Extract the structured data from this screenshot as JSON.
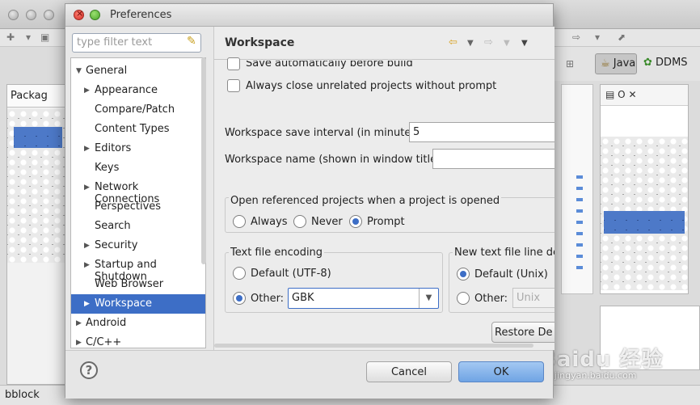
{
  "background": {
    "perspectives": {
      "java": "Java",
      "ddms": "DDMS"
    },
    "package_tab": "Packag",
    "outline_tab": "O",
    "status_text": "bblock",
    "watermark": "Baidu 经验",
    "watermark_sub": "jingyan.baidu.com"
  },
  "dialog": {
    "title": "Preferences",
    "filter_placeholder": "type filter text",
    "tree": [
      {
        "label": "General",
        "expanded": true,
        "level": 0
      },
      {
        "label": "Appearance",
        "expandable": true,
        "level": 1
      },
      {
        "label": "Compare/Patch",
        "level": 1
      },
      {
        "label": "Content Types",
        "level": 1
      },
      {
        "label": "Editors",
        "expandable": true,
        "level": 1
      },
      {
        "label": "Keys",
        "level": 1
      },
      {
        "label": "Network Connections",
        "expandable": true,
        "level": 1
      },
      {
        "label": "Perspectives",
        "level": 1
      },
      {
        "label": "Search",
        "level": 1
      },
      {
        "label": "Security",
        "expandable": true,
        "level": 1
      },
      {
        "label": "Startup and Shutdown",
        "expandable": true,
        "level": 1
      },
      {
        "label": "Web Browser",
        "level": 1
      },
      {
        "label": "Workspace",
        "expandable": true,
        "level": 1,
        "selected": true
      },
      {
        "label": "Android",
        "expandable": true,
        "level": 0
      },
      {
        "label": "C/C++",
        "expandable": true,
        "level": 0
      }
    ],
    "page": {
      "title": "Workspace",
      "save_auto_label": "Save automatically before build",
      "always_close_label": "Always close unrelated projects without prompt",
      "save_interval_label": "Workspace save interval (in minutes):",
      "save_interval_value": "5",
      "workspace_name_label": "Workspace name (shown in window title):",
      "workspace_name_value": "",
      "open_ref_group": "Open referenced projects when a project is opened",
      "open_ref_options": [
        "Always",
        "Never",
        "Prompt"
      ],
      "open_ref_selected": "Prompt",
      "encoding_group": "Text file encoding",
      "encoding_default_label": "Default (UTF-8)",
      "encoding_other_label": "Other:",
      "encoding_other_value": "GBK",
      "line_delim_group": "New text file line del",
      "line_delim_default_label": "Default (Unix)",
      "line_delim_other_label": "Other:",
      "line_delim_other_value": "Unix",
      "restore_button": "Restore De"
    },
    "buttons": {
      "cancel": "Cancel",
      "ok": "OK",
      "help": "?"
    }
  }
}
